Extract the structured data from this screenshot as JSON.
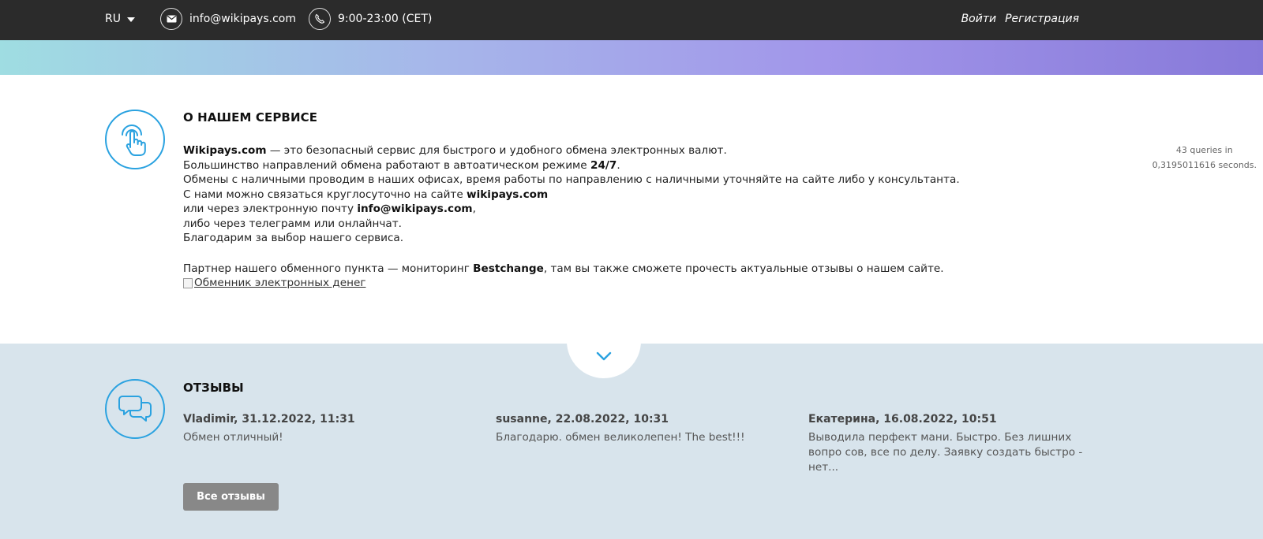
{
  "header": {
    "language": "RU",
    "email": "info@wikipays.com",
    "hours": "9:00-23:00 (CET)",
    "login_label": "Войти",
    "register_label": "Регистрация"
  },
  "about": {
    "title": "О НАШЕМ СЕРВИСЕ",
    "line1_brand": "Wikipays.com",
    "line1_rest": " — это безопасный сервис для быстрого и удобного обмена электронных валют.",
    "line2_start": "Большинство направлений обмена работают в автоатическом режиме ",
    "line2_bold": "24/7",
    "line2_end": ".",
    "line3": "Обмены с наличными проводим в наших офисах, время работы по направлению с наличными уточняйте на сайте либо у консультанта.",
    "line4_start": "С нами можно связаться круглосуточно на сайте ",
    "line4_bold": "wikipays.com",
    "line5_start": "или через электронную почту ",
    "line5_bold": "info@wikipays.com",
    "line5_end": ",",
    "line6": "либо через телеграмм или онлайнчат.",
    "line7": "Благодарим за выбор нашего сервиса.",
    "partner_start": "Партнер нашего обменного пункта — мониторинг ",
    "partner_bold": "Bestchange",
    "partner_end": ", там вы также сможете прочесть актуальные отзывы о нашем сайте.",
    "partner_image_alt": "Обменник электронных денег"
  },
  "debug": {
    "line1": "43 queries in",
    "line2": "0,3195011616 seconds."
  },
  "reviews": {
    "title": "ОТЗЫВЫ",
    "items": [
      {
        "author": "Vladimir, 31.12.2022, 11:31",
        "text": "Обмен отличный!"
      },
      {
        "author": "susanne, 22.08.2022, 10:31",
        "text": "Благодарю. обмен великолепен! The best!!!"
      },
      {
        "author": "Екатерина, 16.08.2022, 10:51",
        "text": "Выводила перфект мани. Быстро. Без лишних вопро сов, все по делу. Заявку создать быстро - нет..."
      }
    ],
    "all_button": "Все отзывы"
  },
  "colors": {
    "accent": "#2aa2e0",
    "topbar": "#2b2b2b",
    "reviews_bg": "#d8e4ec",
    "button": "#888888"
  },
  "icons": {
    "mail": "envelope-icon",
    "phone": "phone-icon",
    "about": "touch-hand-icon",
    "reviews": "speech-bubbles-icon",
    "scroll": "chevron-down-icon"
  }
}
